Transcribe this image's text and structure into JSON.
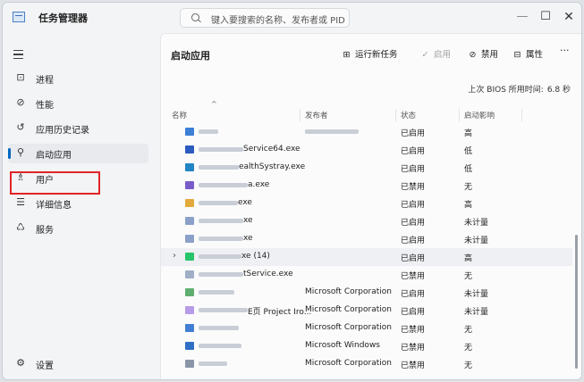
{
  "window": {
    "title": "任务管理器",
    "minimize": "—",
    "maximize": "☐",
    "close": "✕"
  },
  "search": {
    "placeholder": "键入要搜索的名称、发布者或 PID"
  },
  "sidebar": {
    "items": [
      {
        "icon": "⊡",
        "label": "进程",
        "name": "processes"
      },
      {
        "icon": "⊘",
        "label": "性能",
        "name": "performance"
      },
      {
        "icon": "↺",
        "label": "应用历史记录",
        "name": "app-history"
      },
      {
        "icon": "⚲",
        "label": "启动应用",
        "name": "startup-apps",
        "active": true
      },
      {
        "icon": "♗",
        "label": "用户",
        "name": "users"
      },
      {
        "icon": "☰",
        "label": "详细信息",
        "name": "details"
      },
      {
        "icon": "♺",
        "label": "服务",
        "name": "services"
      }
    ],
    "settings": {
      "icon": "⚙",
      "label": "设置"
    }
  },
  "main": {
    "title": "启动应用",
    "toolbar": {
      "run_new_task": "运行新任务",
      "enable": "启用",
      "disable": "禁用",
      "properties": "属性",
      "more": "···"
    },
    "bios_label": "上次 BIOS 所用时间:",
    "bios_value": "6.8 秒",
    "columns": {
      "name": "名称",
      "publisher": "发布者",
      "status": "状态",
      "impact": "启动影响",
      "sort": "^"
    },
    "rows": [
      {
        "name": "",
        "publisher": "",
        "status": "已启用",
        "impact": "高",
        "icon_color": "#3b7fd6",
        "blur": [
          12,
          0
        ],
        "pub_blur": 60
      },
      {
        "name": "Service64.exe",
        "publisher": "",
        "status": "已启用",
        "impact": "低",
        "icon_color": "#2b5cbf",
        "blur": [
          40,
          0
        ]
      },
      {
        "name": "ealthSystray.exe",
        "publisher": "",
        "status": "已启用",
        "impact": "低",
        "icon_color": "#2384c4",
        "blur": [
          35,
          0
        ]
      },
      {
        "name": "a.exe",
        "publisher": "",
        "status": "已禁用",
        "impact": "无",
        "icon_color": "#7a5cc9",
        "blur": [
          45,
          0
        ]
      },
      {
        "name": "exe",
        "publisher": "",
        "status": "已启用",
        "impact": "高",
        "icon_color": "#e2a93b",
        "blur": [
          34,
          0
        ]
      },
      {
        "name": "xe",
        "publisher": "",
        "status": "已启用",
        "impact": "未计量",
        "icon_color": "#8aa0c8",
        "blur": [
          40,
          0
        ]
      },
      {
        "name": "xe",
        "publisher": "",
        "status": "已启用",
        "impact": "未计量",
        "icon_color": "#8aa0c8",
        "blur": [
          40,
          0
        ]
      },
      {
        "name": "xe (14)",
        "publisher": "",
        "status": "已启用",
        "impact": "高",
        "icon_color": "#27c46a",
        "blur": [
          38,
          0
        ],
        "expander": "›",
        "selected": true
      },
      {
        "name": "tService.exe",
        "publisher": "",
        "status": "已禁用",
        "impact": "无",
        "icon_color": "#9fb0c6",
        "blur": [
          40,
          0
        ]
      },
      {
        "name": "",
        "publisher": "Microsoft Corporation",
        "status": "已启用",
        "impact": "未计量",
        "icon_color": "#5fae6f",
        "blur": [
          30,
          0
        ]
      },
      {
        "name": "E页 Project Iro...",
        "publisher": "Microsoft Corporation",
        "status": "已启用",
        "impact": "未计量",
        "icon_color": "#b79be8",
        "blur": [
          45,
          0
        ]
      },
      {
        "name": "",
        "publisher": "Microsoft Corporation",
        "status": "已禁用",
        "impact": "无",
        "icon_color": "#3f7ed2",
        "blur": [
          35,
          0
        ]
      },
      {
        "name": "",
        "publisher": "Microsoft Windows",
        "status": "已禁用",
        "impact": "无",
        "icon_color": "#2f6fc4",
        "blur": [
          38,
          0
        ]
      },
      {
        "name": "",
        "publisher": "Microsoft Corporation",
        "status": "已禁用",
        "impact": "无",
        "icon_color": "#8a96a8",
        "blur": [
          22,
          0
        ]
      }
    ]
  }
}
